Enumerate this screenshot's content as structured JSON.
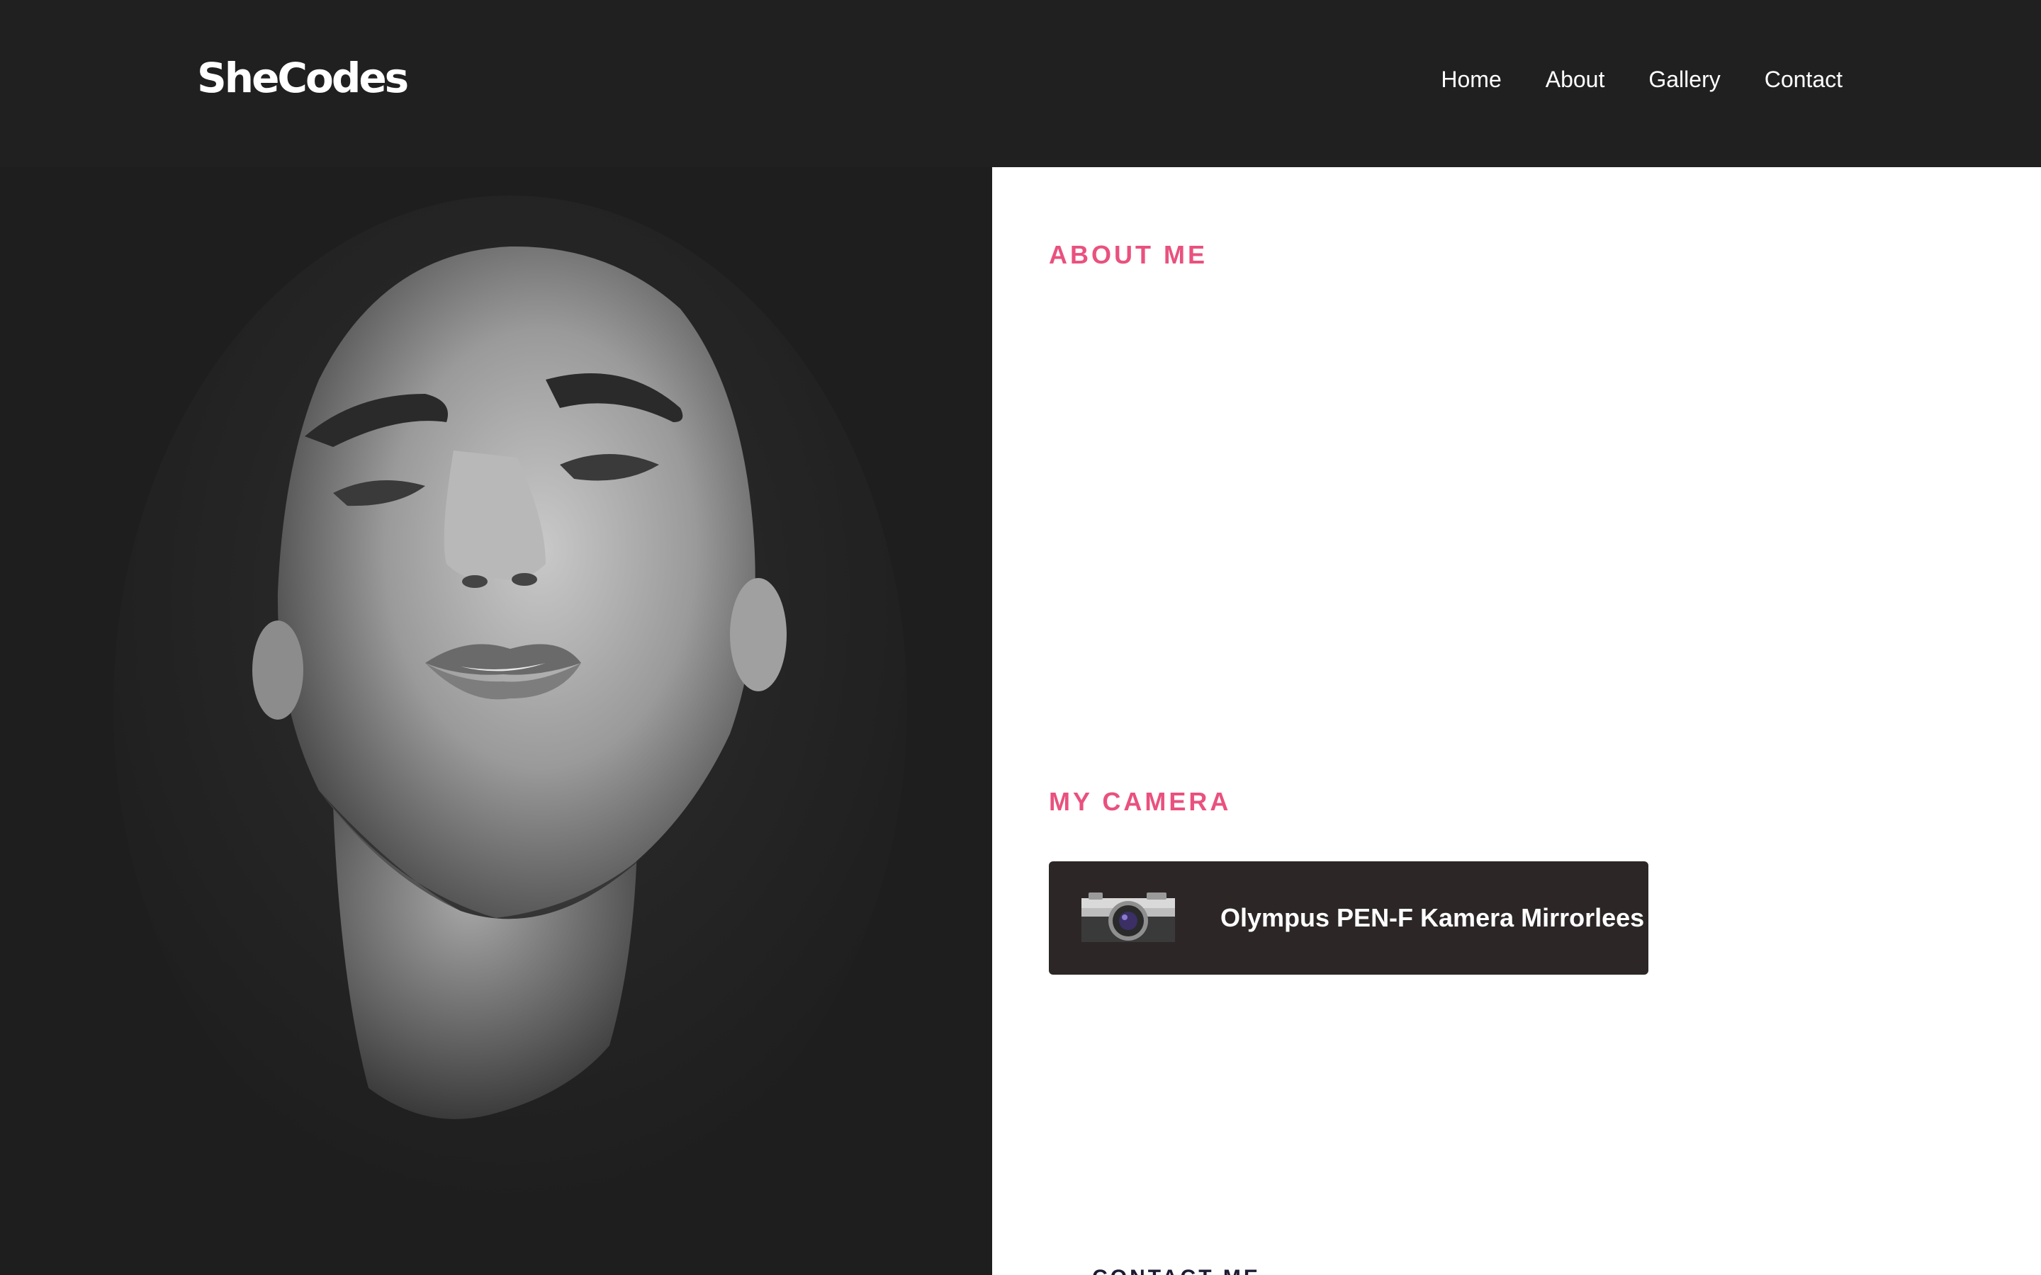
{
  "header": {
    "logo": "SheCodes",
    "nav": [
      {
        "label": "Home"
      },
      {
        "label": "About"
      },
      {
        "label": "Gallery"
      },
      {
        "label": "Contact"
      }
    ]
  },
  "about": {
    "title": "ABOUT ME"
  },
  "camera": {
    "title": "MY CAMERA",
    "name": "Olympus PEN-F Kamera Mirrorlees",
    "icon": "camera-photo"
  },
  "contact": {
    "button_label": "CONTACT ME"
  },
  "colors": {
    "background_dark": "#202020",
    "accent_pink": "#e9517e",
    "card_dark": "#2c2626",
    "contact_text": "#1d1b33",
    "panel_white": "#ffffff"
  }
}
